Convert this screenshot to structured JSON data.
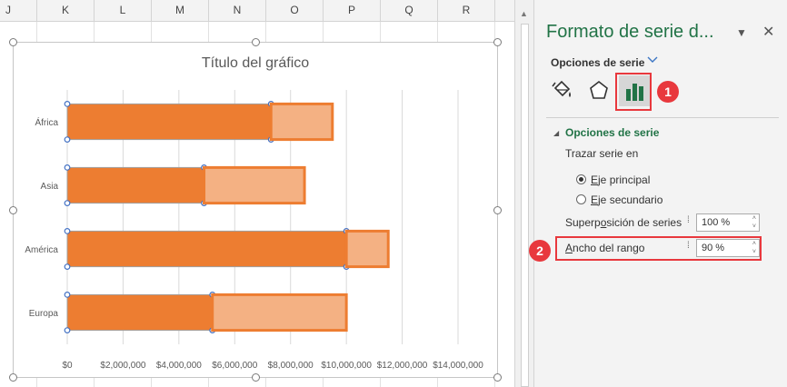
{
  "sheet": {
    "columns": [
      "J",
      "K",
      "L",
      "M",
      "N",
      "O",
      "P",
      "Q",
      "R"
    ]
  },
  "chart_data": {
    "type": "bar",
    "orientation": "horizontal",
    "stacked": true,
    "title": "Título del gráfico",
    "categories": [
      "África",
      "Asia",
      "América",
      "Europa"
    ],
    "series": [
      {
        "values": [
          7300000,
          4900000,
          10000000,
          5200000
        ],
        "color": "#ed7d31"
      },
      {
        "values": [
          2200000,
          3600000,
          1500000,
          4800000
        ],
        "color": "#f4b183"
      }
    ],
    "xlim": [
      0,
      14000000
    ],
    "x_ticks": [
      "$0",
      "$2,000,000",
      "$4,000,000",
      "$6,000,000",
      "$8,000,000",
      "$10,000,000",
      "$12,000,000",
      "$14,000,000"
    ],
    "grid": true,
    "legend": "none"
  },
  "pane": {
    "title": "Formato de serie d...",
    "dropdown_icon": "chevron-down-icon",
    "close_icon": "close-icon",
    "close_glyph": "✕",
    "series_options_tab": "Opciones de serie",
    "icons": [
      "paint-bucket-icon",
      "pentagon-effects-icon",
      "bar-chart-icon"
    ],
    "section_title": "Opciones de serie",
    "plot_on_label": "Trazar serie en",
    "radio_primary": {
      "mnemonic": "E",
      "rest": "je principal",
      "selected": true
    },
    "radio_secondary": {
      "mnemonic": "E",
      "rest": "je secundario",
      "selected": false
    },
    "overlap": {
      "pre": "Superp",
      "mnemonic": "o",
      "post": "sición de series",
      "value": "100 %"
    },
    "gap": {
      "pre": "",
      "mnemonic": "A",
      "post": "ncho del rango",
      "value": "90 %"
    },
    "accent_color": "#217346",
    "highlight_color": "#e8383d"
  },
  "annotations": {
    "badge_1": "1",
    "badge_2": "2"
  }
}
